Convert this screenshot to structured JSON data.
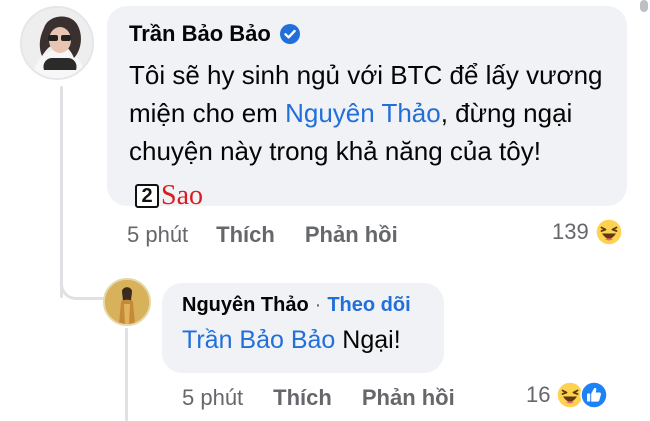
{
  "comment": {
    "author": "Trần Bảo Bảo",
    "verified": true,
    "text_before": "Tôi sẽ hy sinh ngủ với BTC để lấy vương miện cho em ",
    "mention": "Nguyên Thảo",
    "text_after": ", đừng ngại chuyện này trong khả năng của tôy!",
    "watermark": {
      "digit": "2",
      "word": "Sao"
    },
    "time": "5 phút",
    "like_label": "Thích",
    "reply_label": "Phản hồi",
    "reaction_count": "139",
    "reactions": [
      "haha-icon"
    ]
  },
  "reply": {
    "author": "Nguyên Thảo",
    "separator": "·",
    "follow_label": "Theo dõi",
    "mention": "Trần Bảo Bảo",
    "text_after": " Ngại!",
    "time": "5 phút",
    "like_label": "Thích",
    "reply_label": "Phản hồi",
    "reaction_count": "16",
    "reactions": [
      "haha-icon",
      "like-icon"
    ]
  },
  "colors": {
    "link": "#216fdb",
    "bubble": "#f0f2f5",
    "meta": "#65676b",
    "watermark_red": "#d81e25"
  }
}
